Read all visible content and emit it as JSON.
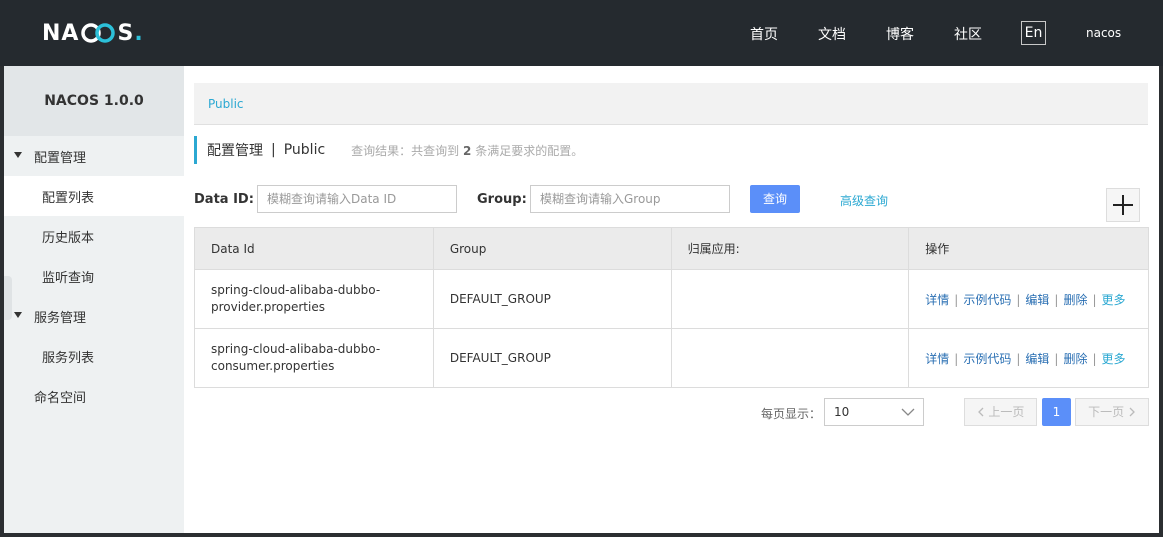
{
  "header": {
    "logo_prefix": "NA",
    "logo_suffix": "S",
    "logo_dot": ".",
    "nav": [
      "首页",
      "文档",
      "博客",
      "社区"
    ],
    "lang": "En",
    "user": "nacos"
  },
  "sidebar": {
    "title": "NACOS 1.0.0",
    "config_group": "配置管理",
    "config_items": [
      "配置列表",
      "历史版本",
      "监听查询"
    ],
    "service_group": "服务管理",
    "service_items": [
      "服务列表"
    ],
    "namespace": "命名空间"
  },
  "breadcrumb": "Public",
  "page": {
    "title": "配置管理",
    "separator": "|",
    "namespace": "Public",
    "result_prefix": "查询结果：共查询到",
    "result_count": "2",
    "result_suffix": "条满足要求的配置。"
  },
  "search": {
    "dataid_label": "Data ID:",
    "dataid_placeholder": "模糊查询请输入Data ID",
    "group_label": "Group:",
    "group_placeholder": "模糊查询请输入Group",
    "query_button": "查询",
    "advanced_link": "高级查询"
  },
  "table": {
    "headers": [
      "Data Id",
      "Group",
      "归属应用:",
      "操作"
    ],
    "rows": [
      {
        "data_id_line1": "spring-cloud-alibaba-dubbo-",
        "data_id_line2": "provider.properties",
        "group": "DEFAULT_GROUP",
        "app": ""
      },
      {
        "data_id_line1": "spring-cloud-alibaba-dubbo-",
        "data_id_line2": "consumer.properties",
        "group": "DEFAULT_GROUP",
        "app": ""
      }
    ],
    "ops": [
      "详情",
      "示例代码",
      "编辑",
      "删除",
      "更多"
    ],
    "op_separator": "|"
  },
  "pagination": {
    "label": "每页显示：",
    "page_size": "10",
    "prev": "上一页",
    "current": "1",
    "next": "下一页"
  },
  "colors": {
    "header_bg": "#252a2f",
    "accent": "#2ba8d2",
    "primary_button": "#5b8ff9",
    "link": "#2a6fb3"
  }
}
